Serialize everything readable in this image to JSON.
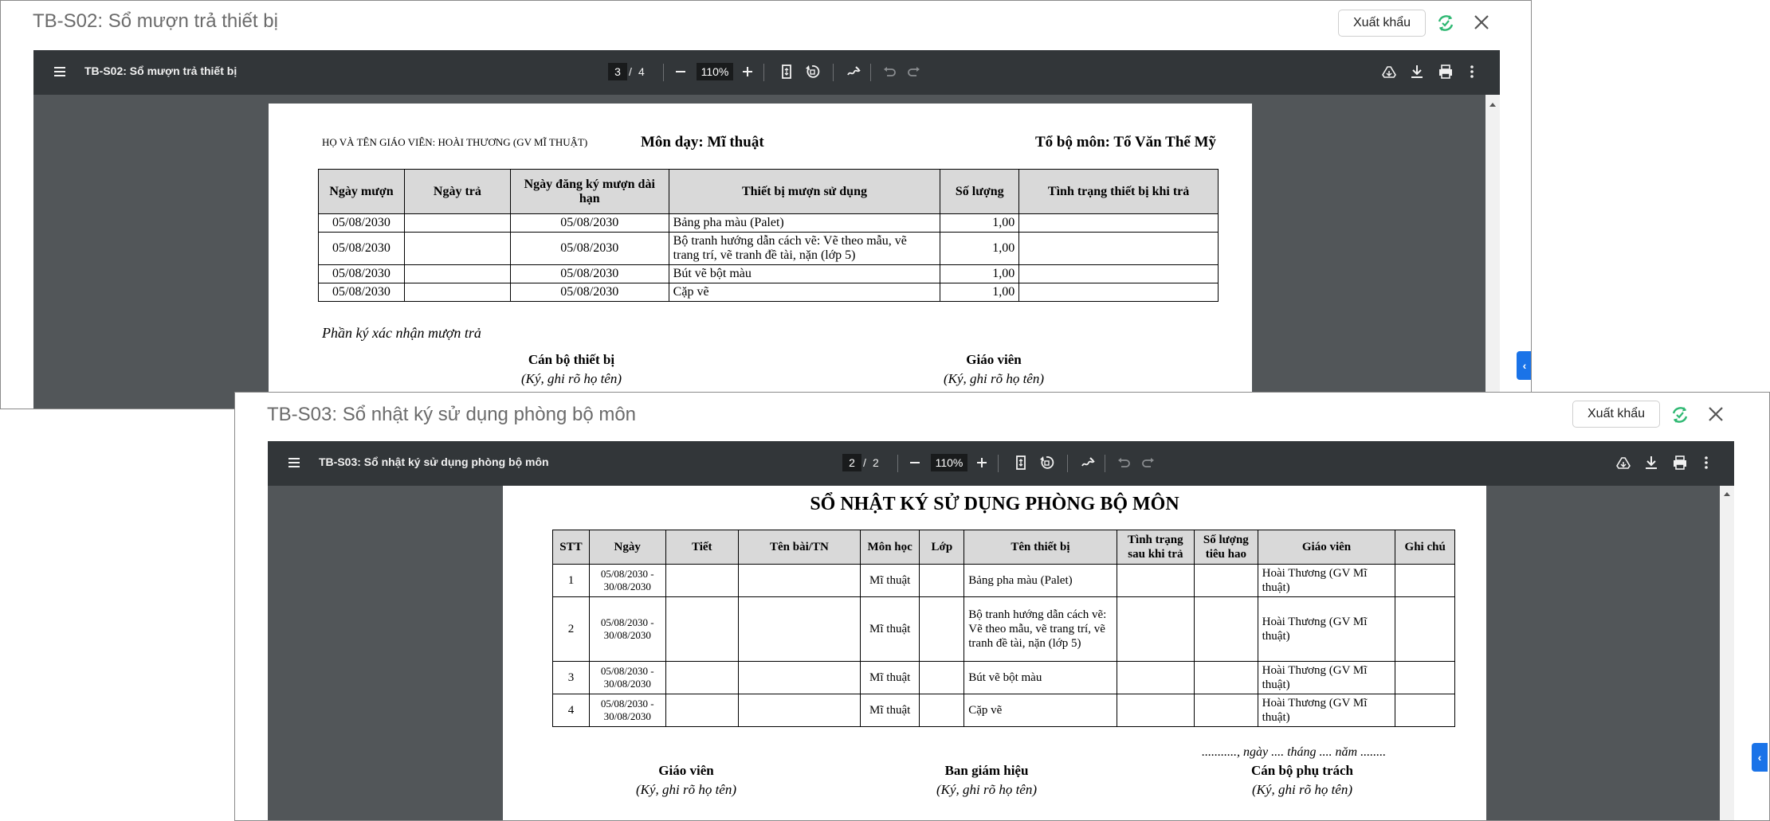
{
  "dialogs": [
    {
      "title": "TB-S02: Sổ mượn trả thiết bị",
      "export_label": "Xuất khẩu",
      "viewer": {
        "title": "TB-S02: Sổ mượn trả thiết bị",
        "page_current": "3",
        "page_sep": "/",
        "page_total": "4",
        "zoom": "110%"
      },
      "doc": {
        "teacher_label": "HỌ VÀ TÊN GIÁO VIÊN: HOÀI THƯƠNG (GV MĨ THUẬT)",
        "subject": "Môn dạy: Mĩ thuật",
        "dept": "Tổ bộ môn: Tổ Văn Thể Mỹ",
        "headers": [
          "Ngày mượn",
          "Ngày trả",
          "Ngày đăng ký mượn dài hạn",
          "Thiết bị mượn sử dụng",
          "Số lượng",
          "Tình trạng thiết bị khi trả"
        ],
        "rows": [
          [
            "05/08/2030",
            "",
            "05/08/2030",
            "Bảng pha màu (Palet)",
            "1,00",
            ""
          ],
          [
            "05/08/2030",
            "",
            "05/08/2030",
            "Bộ tranh hướng dẫn cách vẽ: Vẽ theo mẫu, vẽ trang trí, vẽ tranh đề tài, nặn (lớp 5)",
            "1,00",
            ""
          ],
          [
            "05/08/2030",
            "",
            "05/08/2030",
            "Bút vẽ bột màu",
            "1,00",
            ""
          ],
          [
            "05/08/2030",
            "",
            "05/08/2030",
            "Cặp vẽ",
            "1,00",
            ""
          ]
        ],
        "confirm_label": "Phần ký xác nhận mượn trả",
        "sig_left_title": "Cán bộ thiết bị",
        "sig_left_note": "(Ký, ghi rõ họ tên)",
        "sig_right_title": "Giáo viên",
        "sig_right_note": "(Ký, ghi rõ họ tên)"
      }
    },
    {
      "title": "TB-S03: Sổ nhật ký sử dụng phòng bộ môn",
      "export_label": "Xuất khẩu",
      "viewer": {
        "title": "TB-S03: Sổ nhật ký sử dụng phòng bộ môn",
        "page_current": "2",
        "page_sep": "/",
        "page_total": "2",
        "zoom": "110%"
      },
      "doc": {
        "heading": "SỔ NHẬT KÝ SỬ DỤNG PHÒNG BỘ MÔN",
        "headers": [
          "STT",
          "Ngày",
          "Tiết",
          "Tên bài/TN",
          "Môn học",
          "Lớp",
          "Tên thiết bị",
          "Tình trạng sau khi trả",
          "Số lượng tiêu hao",
          "Giáo viên",
          "Ghi chú"
        ],
        "rows": [
          [
            "1",
            "05/08/2030 - 30/08/2030",
            "",
            "",
            "Mĩ thuật",
            "",
            "Bảng pha màu (Palet)",
            "",
            "",
            "Hoài Thương (GV Mĩ thuật)",
            ""
          ],
          [
            "2",
            "05/08/2030 - 30/08/2030",
            "",
            "",
            "Mĩ thuật",
            "",
            "Bộ tranh hướng dẫn cách vẽ: Vẽ theo mẫu, vẽ trang trí, vẽ tranh đề tài, nặn (lớp 5)",
            "",
            "",
            "Hoài Thương (GV Mĩ thuật)",
            ""
          ],
          [
            "3",
            "05/08/2030 - 30/08/2030",
            "",
            "",
            "Mĩ thuật",
            "",
            "Bút vẽ bột màu",
            "",
            "",
            "Hoài Thương (GV Mĩ thuật)",
            ""
          ],
          [
            "4",
            "05/08/2030 - 30/08/2030",
            "",
            "",
            "Mĩ thuật",
            "",
            "Cặp vẽ",
            "",
            "",
            "Hoài Thương (GV Mĩ thuật)",
            ""
          ]
        ],
        "date_line": "..........., ngày .... tháng .... năm ........",
        "sig1_title": "Giáo viên",
        "sig1_note": "(Ký, ghi rõ họ tên)",
        "sig2_title": "Ban giám hiệu",
        "sig2_note": "(Ký, ghi rõ họ tên)",
        "sig3_title": "Cán bộ phụ trách",
        "sig3_note": "(Ký, ghi rõ họ tên)"
      }
    }
  ],
  "colors": {
    "accent": "#1a73e8",
    "refresh_green": "#2eb872",
    "toolbar": "#323639",
    "viewer_bg": "#525659"
  },
  "icons": [
    "menu-icon",
    "fit-page-icon",
    "rotate-icon",
    "annotate-icon",
    "undo-icon",
    "redo-icon",
    "drive-save-icon",
    "download-icon",
    "print-icon",
    "more-icon",
    "refresh-icon",
    "close-icon"
  ]
}
